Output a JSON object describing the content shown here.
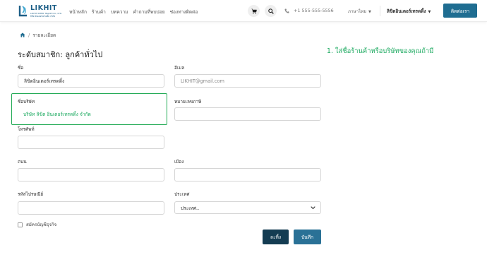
{
  "brand": {
    "name": "LIKHIT",
    "tagline": "LIKHIT INTER TRADE CO., LTD.",
    "sub_tagline": "ลิขิต อินเตอร์เทรดดิ้ง จำกัด"
  },
  "nav": {
    "items": [
      "หน้าหลัก",
      "ร้านค้า",
      "บทความ",
      "คำถามที่พบบ่อย",
      "ช่องทางติดต่อ"
    ]
  },
  "header": {
    "phone": "+1 555-555-5556",
    "language": "ภาษาไทย",
    "account": "ลิขิตอินเตอร์เทรดดิ้ง",
    "contact_button": "ติดต่อเรา",
    "cart_icon": "cart-icon",
    "search_icon": "search-icon",
    "phone_icon": "phone-icon"
  },
  "breadcrumb": {
    "home_icon": "home-icon",
    "current": "รายละเอียด"
  },
  "page": {
    "title": "ระดับสมาชิก: ลูกค้าทั่วไป",
    "hint": "1. ใส่ชื่อร้านค้าหรือบริษัทของคุณถ้ามี"
  },
  "form": {
    "name_label": "ชื่อ",
    "name_value": "ลิขิตอินเตอร์เทรดดิ้ง",
    "email_label": "อีเมล",
    "email_value": "LIKHIT@gmail.com",
    "company_label": "ชื่อบริษัท",
    "company_value": "บริษัท ลิขิต อินเตอร์เทรดดิ้ง จำกัด",
    "tax_label": "หมายเลขภาษี",
    "tax_value": "",
    "phone_label": "โทรศัพท์",
    "phone_value": "",
    "street_label": "ถนน",
    "street_value": "",
    "city_label": "เมือง",
    "city_value": "",
    "zip_label": "รหัสไปรษณีย์",
    "zip_value": "",
    "country_label": "ประเทศ",
    "country_value": "ประเทศ..",
    "business_checkbox_label": "สมัครบัญชีธุรกิจ",
    "cancel_button": "ละทิ้ง",
    "save_button": "บันทึก"
  },
  "colors": {
    "primary": "#2a7196",
    "dark": "#143c52",
    "highlight": "#22aa55",
    "hint_text": "#1eaa61"
  }
}
